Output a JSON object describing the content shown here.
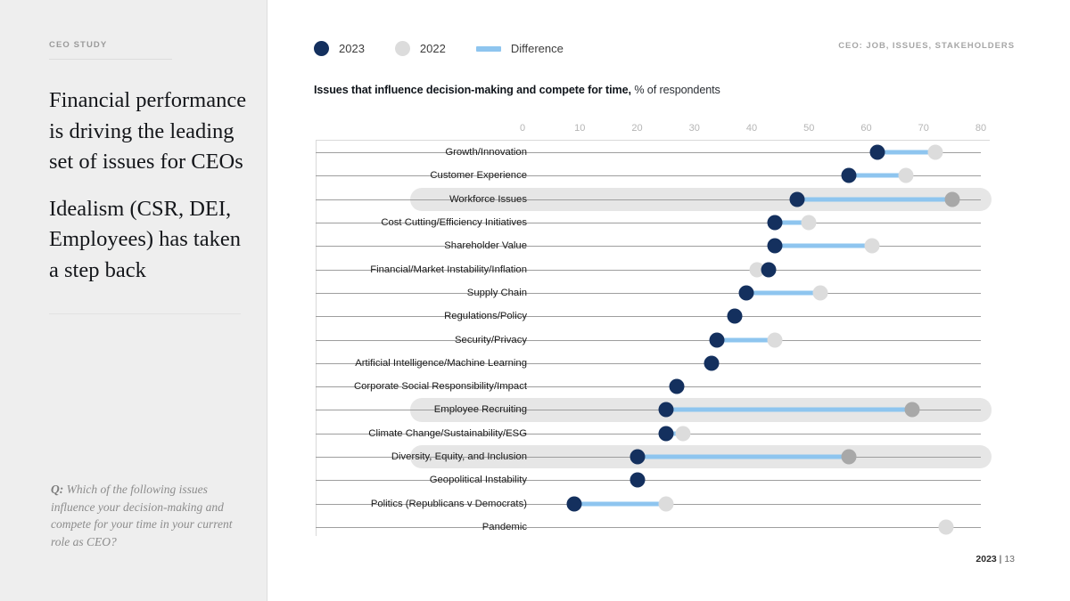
{
  "sidebar": {
    "eyebrow": "CEO STUDY",
    "headline_p1": "Financial performance is driving the leading set of issues for CEOs",
    "headline_p2": "Idealism (CSR, DEI, Employees) has taken a step back",
    "question_prefix": "Q:",
    "question_text": " Which of the following issues influence your decision-making and compete for your time in your current role as CEO?"
  },
  "header": {
    "right_label": "CEO: JOB, ISSUES, STAKEHOLDERS"
  },
  "footer": {
    "year": "2023",
    "separator": " | ",
    "page": "13"
  },
  "legend": {
    "items": [
      {
        "label": "2023",
        "color": "#14305e",
        "shape": "dot"
      },
      {
        "label": "2022",
        "color": "#dcdcdc",
        "shape": "dot"
      },
      {
        "label": "Difference",
        "color": "#8ec5ef",
        "shape": "bar"
      }
    ]
  },
  "chart_data": {
    "type": "scatter",
    "subtype": "dumbbell",
    "title": "Issues that influence decision-making and compete for time,",
    "subtitle": "% of respondents",
    "xlabel": "",
    "ylabel": "",
    "xlim": [
      0,
      80
    ],
    "xticks": [
      0,
      10,
      20,
      30,
      40,
      50,
      60,
      70,
      80
    ],
    "grid": true,
    "legend_position": "top-left",
    "categories": [
      "Growth/Innovation",
      "Customer Experience",
      "Workforce Issues",
      "Cost Cutting/Efficiency Initiatives",
      "Shareholder Value",
      "Financial/Market Instability/Inflation",
      "Supply Chain",
      "Regulations/Policy",
      "Security/Privacy",
      "Artificial Intelligence/Machine Learning",
      "Corporate Social Responsibility/Impact",
      "Employee Recruiting",
      "Climate Change/Sustainability/ESG",
      "Diversity, Equity, and Inclusion",
      "Geopolitical Instability",
      "Politics (Republicans v Democrats)",
      "Pandemic"
    ],
    "series": [
      {
        "name": "2023",
        "color": "#14305e",
        "values": [
          62,
          57,
          48,
          44,
          44,
          43,
          39,
          37,
          34,
          33,
          27,
          25,
          25,
          20,
          20,
          9,
          null
        ]
      },
      {
        "name": "2022",
        "color": "#dcdcdc",
        "values": [
          72,
          67,
          75,
          50,
          61,
          41,
          52,
          null,
          44,
          null,
          null,
          68,
          28,
          57,
          null,
          25,
          74
        ]
      }
    ],
    "highlighted_categories": [
      "Workforce Issues",
      "Employee Recruiting",
      "Diversity, Equity, and Inclusion"
    ]
  }
}
